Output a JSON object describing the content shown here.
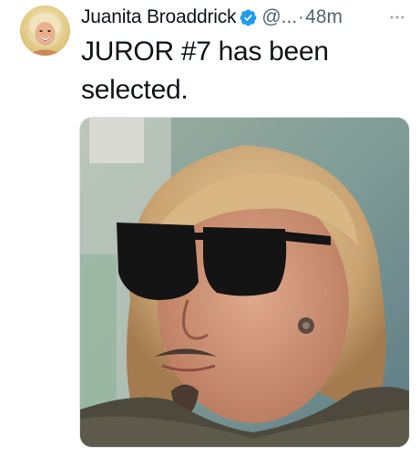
{
  "tweet": {
    "author": {
      "display_name": "Juanita Broaddrick",
      "verified": true,
      "avatar_icon": "profile-photo"
    },
    "handle": "@...",
    "separator": "·",
    "time": "48m",
    "more_icon": "ellipsis-icon",
    "text": "JUROR #7 has been selected.",
    "media": {
      "type": "photo",
      "description_icon": "meme-photo"
    }
  },
  "colors": {
    "text_primary": "#0f1419",
    "text_secondary": "#536471",
    "verified_blue": "#1d9bf0"
  }
}
